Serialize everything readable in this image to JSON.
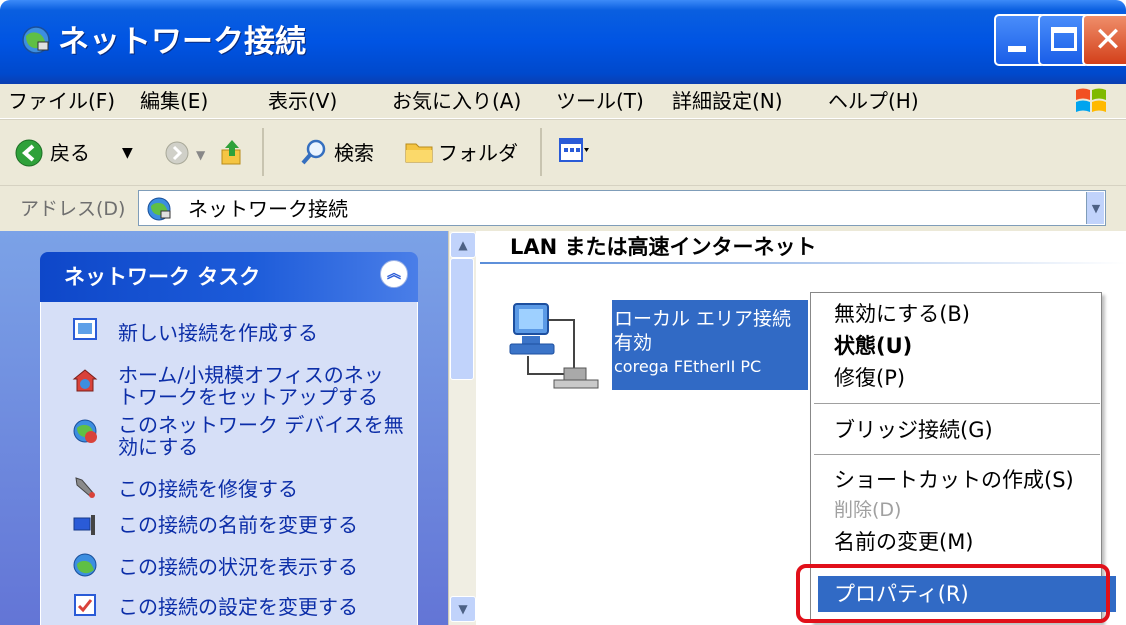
{
  "window": {
    "title": "ネットワーク接続",
    "buttons": [
      "minimize",
      "maximize",
      "close"
    ]
  },
  "menubar": {
    "items": [
      "ファイル(F)",
      "編集(E)",
      "表示(V)",
      "お気に入り(A)",
      "ツール(T)",
      "詳細設定(N)",
      "ヘルプ(H)"
    ]
  },
  "toolbar": {
    "back_label": "戻る",
    "search_label": "検索",
    "folder_label": "フォルダ"
  },
  "address": {
    "label": "アドレス(D)",
    "value": "ネットワーク接続"
  },
  "taskpane": {
    "title": "ネットワーク タスク",
    "tasks": [
      "新しい接続を作成する",
      "ホーム/小規模オフィスのネットワークをセットアップする",
      "このネットワーク デバイスを無効にする",
      "この接続を修復する",
      "この接続の名前を変更する",
      "この接続の状況を表示する",
      "この接続の設定を変更する"
    ],
    "task_lines": [
      [
        "新しい接続を作成する"
      ],
      [
        "ホーム/小規模オフィスのネッ",
        "トワークをセットアップする"
      ],
      [
        "このネットワーク デバイスを無",
        "効にする"
      ],
      [
        "この接続を修復する"
      ],
      [
        "この接続の名前を変更する"
      ],
      [
        "この接続の状況を表示する"
      ],
      [
        "この接続の設定を変更する"
      ]
    ]
  },
  "content": {
    "group_header": "LAN または高速インターネット",
    "connection": {
      "name": "ローカル エリア接続",
      "status": "有効",
      "device": "corega FEtherII PC"
    }
  },
  "context_menu": {
    "items": [
      {
        "label": "無効にする(B)",
        "enabled": true
      },
      {
        "label": "状態(U)",
        "enabled": true,
        "bold": true
      },
      {
        "label": "修復(P)",
        "enabled": true
      },
      {
        "label": "ブリッジ接続(G)",
        "enabled": true
      },
      {
        "label": "ショートカットの作成(S)",
        "enabled": true
      },
      {
        "label": "削除(D)",
        "enabled": false
      },
      {
        "label": "名前の変更(M)",
        "enabled": true
      },
      {
        "label": "プロパティ(R)",
        "enabled": true,
        "selected": true
      }
    ]
  },
  "colors": {
    "titlebar": "#0054e3",
    "selection": "#316ac5",
    "highlight_border": "#e1101a"
  }
}
